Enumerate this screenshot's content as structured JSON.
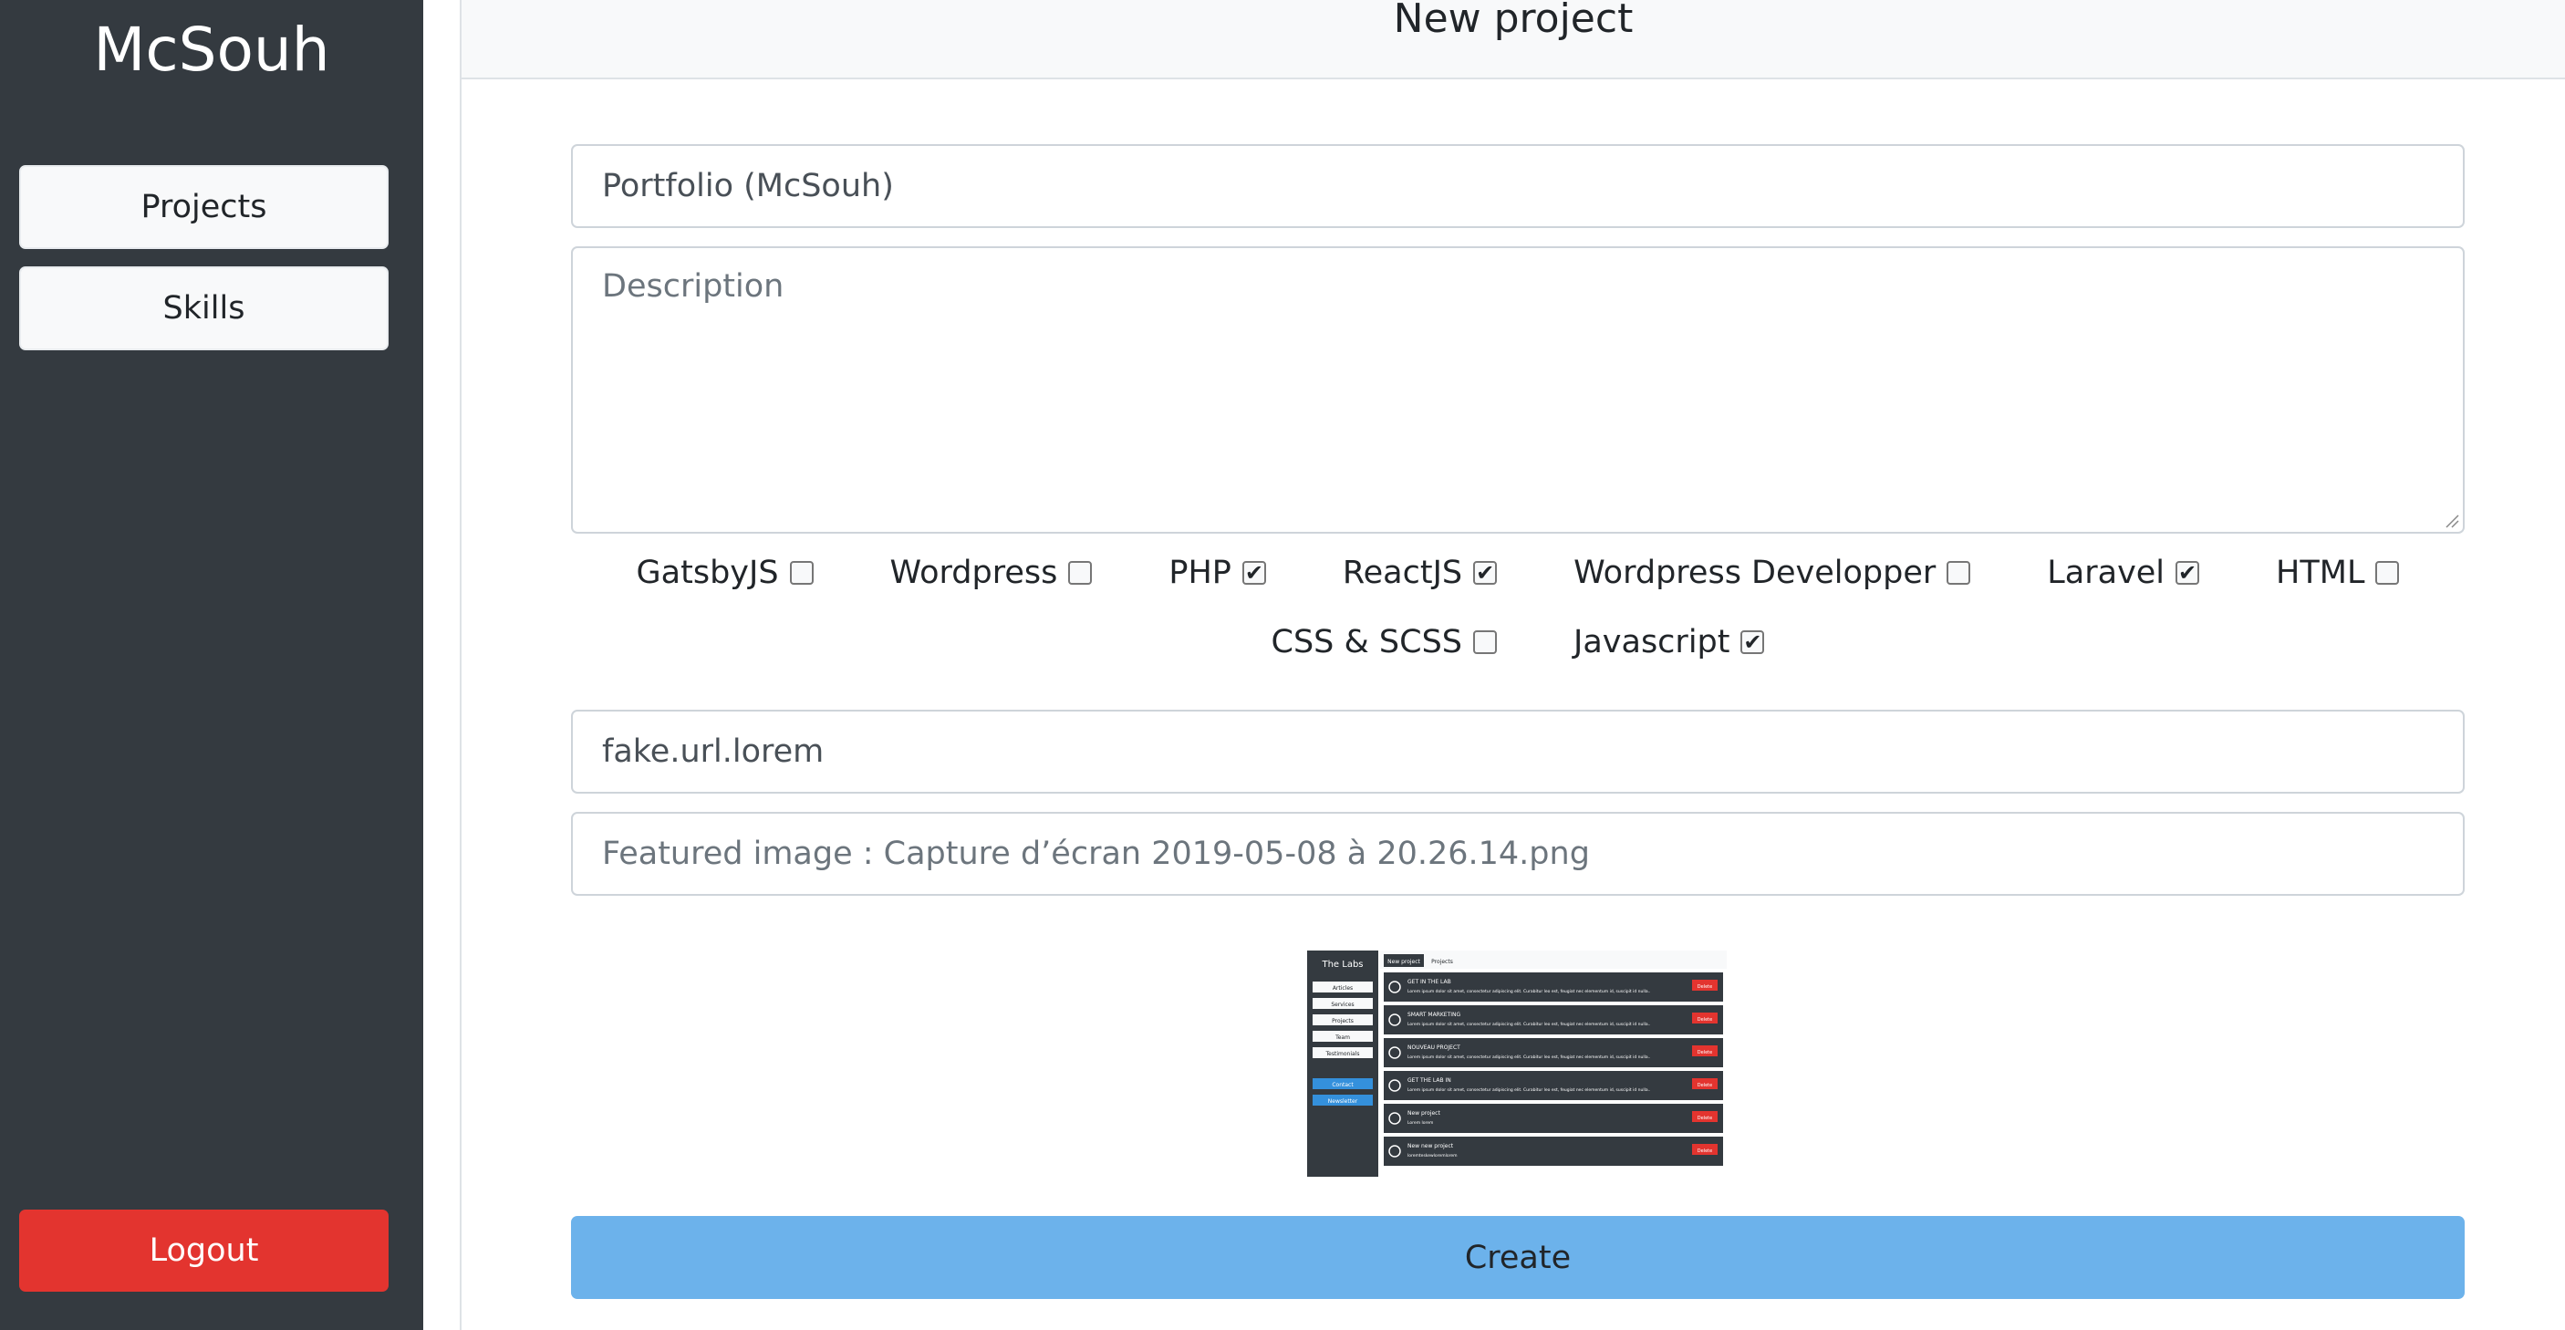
{
  "sidebar": {
    "brand": "McSouh",
    "items": [
      {
        "label": "Projects"
      },
      {
        "label": "Skills"
      }
    ],
    "logout_label": "Logout"
  },
  "header": {
    "title": "New project"
  },
  "form": {
    "title_value": "Portfolio (McSouh)",
    "description_placeholder": "Description",
    "skills": [
      {
        "label": "GatsbyJS",
        "checked": false
      },
      {
        "label": "Wordpress",
        "checked": false
      },
      {
        "label": "PHP",
        "checked": true
      },
      {
        "label": "ReactJS",
        "checked": true
      },
      {
        "label": "Wordpress Developper",
        "checked": false
      },
      {
        "label": "Laravel",
        "checked": true
      },
      {
        "label": "HTML",
        "checked": false
      },
      {
        "label": "CSS & SCSS",
        "checked": false
      },
      {
        "label": "Javascript",
        "checked": true
      }
    ],
    "url_value": "fake.url.lorem",
    "featured_image_text": "Featured image : Capture d’écran 2019-05-08 à 20.26.14.png",
    "create_label": "Create"
  },
  "preview": {
    "brand": "The Labs",
    "menu": [
      "Articles",
      "Services",
      "Projects",
      "Team",
      "Testimonials"
    ],
    "buttons": [
      "Contact",
      "Newsletter"
    ],
    "tabs": [
      "New project",
      "Projects"
    ],
    "rows": [
      {
        "title": "GET IN THE LAB",
        "text": "Lorem ipsum dolor sit amet, consectetur adipiscing elit. Curabitur leo est, feugiat nec elementum id, suscipit id nulla.."
      },
      {
        "title": "SMART MARKETING",
        "text": "Lorem ipsum dolor sit amet, consectetur adipiscing elit. Curabitur leo est, feugiat nec elementum id, suscipit id nulla.."
      },
      {
        "title": "NOUVEAU PROJECT",
        "text": "Lorem ipsum dolor sit amet, consectetur adipiscing elit. Curabitur leo est, feugiat nec elementum id, suscipit id nulla.."
      },
      {
        "title": "GET THE LAB IN",
        "text": "Lorem ipsum dolor sit amet, consectetur adipiscing elit. Curabitur leo est, feugiat nec elementum id, suscipit id nulla.."
      },
      {
        "title": "New project",
        "text": "Lorem lorem"
      },
      {
        "title": "New new project",
        "text": "loremteskewloremlorem"
      }
    ],
    "delete_label": "Delete"
  },
  "colors": {
    "sidebar_bg": "#343a40",
    "logout_red": "#e3342f",
    "create_blue": "#6cb2eb",
    "header_bg": "#f8f9fa"
  }
}
